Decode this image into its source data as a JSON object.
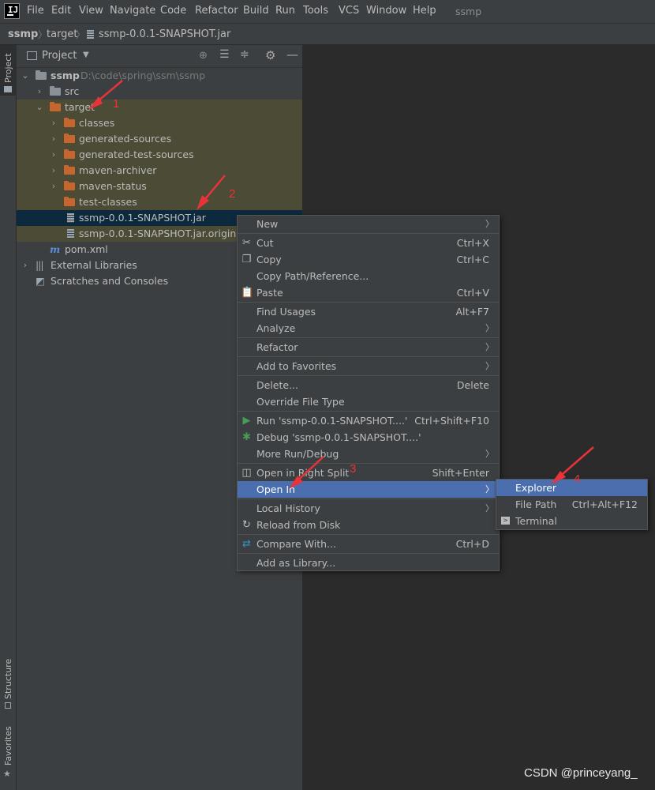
{
  "menubar": {
    "items": [
      "File",
      "Edit",
      "View",
      "Navigate",
      "Code",
      "Refactor",
      "Build",
      "Run",
      "Tools",
      "VCS",
      "Window",
      "Help"
    ],
    "window_title": "ssmp"
  },
  "breadcrumb": [
    "ssmp",
    "target",
    "ssmp-0.0.1-SNAPSHOT.jar"
  ],
  "side_tabs": {
    "project": "Project",
    "structure": "Structure",
    "favorites": "Favorites"
  },
  "panel": {
    "title": "Project"
  },
  "tree": {
    "root_name": "ssmp",
    "root_path": "D:\\code\\spring\\ssm\\ssmp",
    "src": "src",
    "target": "target",
    "children": [
      "classes",
      "generated-sources",
      "generated-test-sources",
      "maven-archiver",
      "maven-status",
      "test-classes"
    ],
    "jar": "ssmp-0.0.1-SNAPSHOT.jar",
    "jar_original": "ssmp-0.0.1-SNAPSHOT.jar.original",
    "pom": "pom.xml",
    "external_libraries": "External Libraries",
    "scratches": "Scratches and Consoles"
  },
  "context_menu": {
    "new": "New",
    "cut": "Cut",
    "cut_key": "Ctrl+X",
    "copy": "Copy",
    "copy_key": "Ctrl+C",
    "copy_path": "Copy Path/Reference...",
    "paste": "Paste",
    "paste_key": "Ctrl+V",
    "find_usages": "Find Usages",
    "find_usages_key": "Alt+F7",
    "analyze": "Analyze",
    "refactor": "Refactor",
    "add_favorites": "Add to Favorites",
    "delete": "Delete...",
    "delete_key": "Delete",
    "override_type": "Override File Type",
    "run": "Run 'ssmp-0.0.1-SNAPSHOT....'",
    "run_key": "Ctrl+Shift+F10",
    "debug": "Debug 'ssmp-0.0.1-SNAPSHOT....'",
    "more_run": "More Run/Debug",
    "open_right_split": "Open in Right Split",
    "open_right_split_key": "Shift+Enter",
    "open_in": "Open In",
    "local_history": "Local History",
    "reload": "Reload from Disk",
    "compare": "Compare With...",
    "compare_key": "Ctrl+D",
    "add_library": "Add as Library..."
  },
  "submenu": {
    "explorer": "Explorer",
    "file_path": "File Path",
    "file_path_key": "Ctrl+Alt+F12",
    "terminal": "Terminal"
  },
  "annotations": [
    "1",
    "2",
    "3",
    "4"
  ],
  "watermark": "CSDN @princeyang_",
  "colors": {
    "highlight": "#4b6eaf",
    "arrow": "#e8333a",
    "excluded_bg": "#4c4b35",
    "folder_orange": "#c7652e"
  }
}
